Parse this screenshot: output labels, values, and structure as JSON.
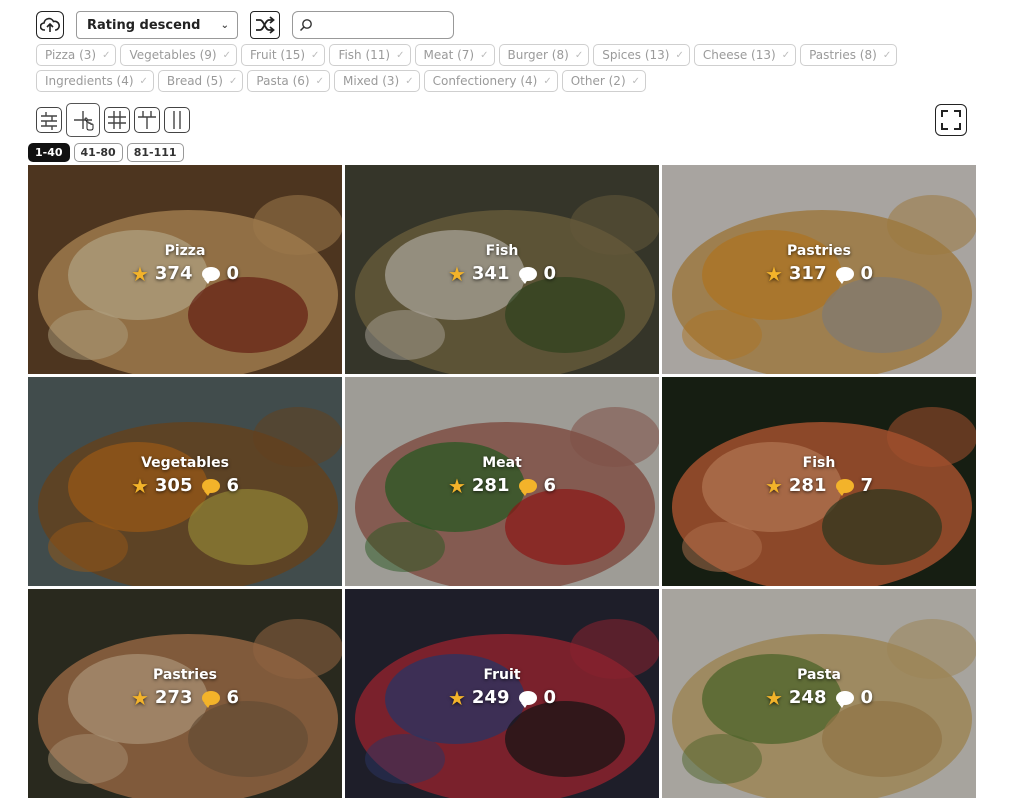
{
  "toolbar": {
    "sort_value": "Rating descend",
    "search_placeholder": ""
  },
  "chips": [
    {
      "label": "Pizza (3)"
    },
    {
      "label": "Vegetables (9)"
    },
    {
      "label": "Fruit (15)"
    },
    {
      "label": "Fish (11)"
    },
    {
      "label": "Meat (7)"
    },
    {
      "label": "Burger (8)"
    },
    {
      "label": "Spices (13)"
    },
    {
      "label": "Cheese (13)"
    },
    {
      "label": "Pastries (8)"
    },
    {
      "label": "Ingredients (4)"
    },
    {
      "label": "Bread (5)"
    },
    {
      "label": "Pasta (6)"
    },
    {
      "label": "Mixed (3)"
    },
    {
      "label": "Confectionery (4)"
    },
    {
      "label": "Other (2)"
    }
  ],
  "view_modes": [
    "rows-icon",
    "grid-2-icon",
    "grid-3-icon",
    "grid-4-icon",
    "columns-icon"
  ],
  "active_view_mode": 1,
  "pages": [
    {
      "label": "1-40",
      "active": true
    },
    {
      "label": "41-80",
      "active": false
    },
    {
      "label": "81-111",
      "active": false
    }
  ],
  "tiles": [
    {
      "category": "Pizza",
      "rating": "374",
      "comments": "0",
      "has_comments": false,
      "palette": [
        "#6b4a2b",
        "#d9a86a",
        "#f2dcb0",
        "#8a2a1a"
      ]
    },
    {
      "category": "Fish",
      "rating": "341",
      "comments": "0",
      "has_comments": false,
      "palette": [
        "#4a4a3a",
        "#8a7a50",
        "#e8e0d0",
        "#3f5a2a"
      ]
    },
    {
      "category": "Pastries",
      "rating": "317",
      "comments": "0",
      "has_comments": false,
      "palette": [
        "#e9e4de",
        "#d8a85a",
        "#f0a030",
        "#b0a8a0"
      ]
    },
    {
      "category": "Vegetables",
      "rating": "305",
      "comments": "6",
      "has_comments": true,
      "palette": [
        "#5a6a6a",
        "#8a5a2a",
        "#d07a20",
        "#c8b84a"
      ]
    },
    {
      "category": "Meat",
      "rating": "281",
      "comments": "6",
      "has_comments": true,
      "palette": [
        "#dcd8d0",
        "#b07060",
        "#3a7a30",
        "#c02020"
      ]
    },
    {
      "category": "Fish",
      "rating": "281",
      "comments": "7",
      "has_comments": true,
      "palette": [
        "#1f2a1a",
        "#e07040",
        "#f3a070",
        "#3a4a2a"
      ]
    },
    {
      "category": "Pastries",
      "rating": "273",
      "comments": "6",
      "has_comments": true,
      "palette": [
        "#3a3a2a",
        "#c88a5a",
        "#e8c8a0",
        "#8a6a4a"
      ]
    },
    {
      "category": "Fruit",
      "rating": "249",
      "comments": "0",
      "has_comments": false,
      "palette": [
        "#2a2a3a",
        "#c03040",
        "#3a4a8a",
        "#1a1a1a"
      ]
    },
    {
      "category": "Pasta",
      "rating": "248",
      "comments": "0",
      "has_comments": false,
      "palette": [
        "#e8e4dc",
        "#d8b878",
        "#6a8a3a",
        "#c8a060"
      ]
    }
  ]
}
